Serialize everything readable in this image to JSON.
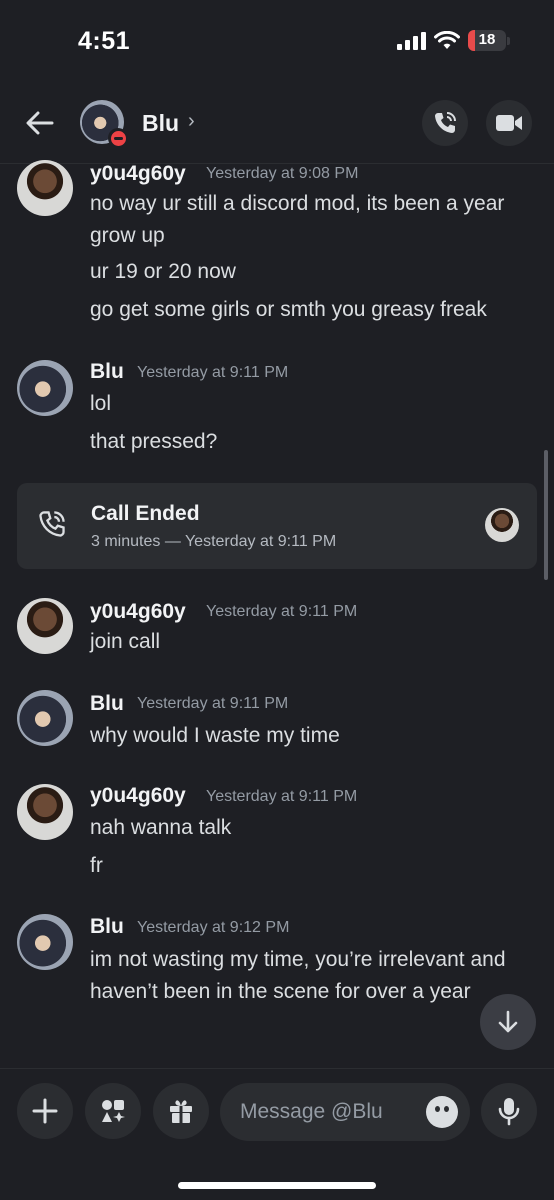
{
  "status_bar": {
    "time": "4:51",
    "battery": "18",
    "battery_level": 0.18
  },
  "header": {
    "name": "Blu",
    "chevron": "›"
  },
  "messages": [
    {
      "author": "y0u4g60y",
      "timestamp": "Yesterday at 9:08 PM",
      "lines": [
        "no way ur still a discord mod, its been a year grow up",
        "ur 19 or 20 now",
        "go get some girls or smth you greasy freak"
      ]
    },
    {
      "author": "Blu",
      "timestamp": "Yesterday at 9:11 PM",
      "lines": [
        "lol",
        "that pressed?"
      ]
    },
    {
      "author": "y0u4g60y",
      "timestamp": "Yesterday at 9:11 PM",
      "lines": [
        "join call"
      ]
    },
    {
      "author": "Blu",
      "timestamp": "Yesterday at 9:11 PM",
      "lines": [
        "why would I waste my time"
      ]
    },
    {
      "author": "y0u4g60y",
      "timestamp": "Yesterday at 9:11 PM",
      "lines": [
        "nah wanna talk",
        "fr"
      ]
    },
    {
      "author": "Blu",
      "timestamp": "Yesterday at 9:12 PM",
      "lines": [
        "im not wasting my time, you’re irrelevant and haven’t been in the scene for over a year"
      ]
    }
  ],
  "call": {
    "title": "Call Ended",
    "subtitle": "3 minutes — Yesterday at 9:11 PM"
  },
  "composer": {
    "placeholder": "Message @Blu"
  },
  "colors": {
    "background": "#1e1f24",
    "surface": "#2b2d31",
    "dnd": "#ed4245",
    "battery_low": "#e94b4b"
  },
  "icons": [
    "back-arrow-icon",
    "phone-icon",
    "video-icon",
    "call-ended-icon",
    "plus-icon",
    "apps-icon",
    "gift-icon",
    "emoji-icon",
    "microphone-icon",
    "arrow-down-icon"
  ]
}
